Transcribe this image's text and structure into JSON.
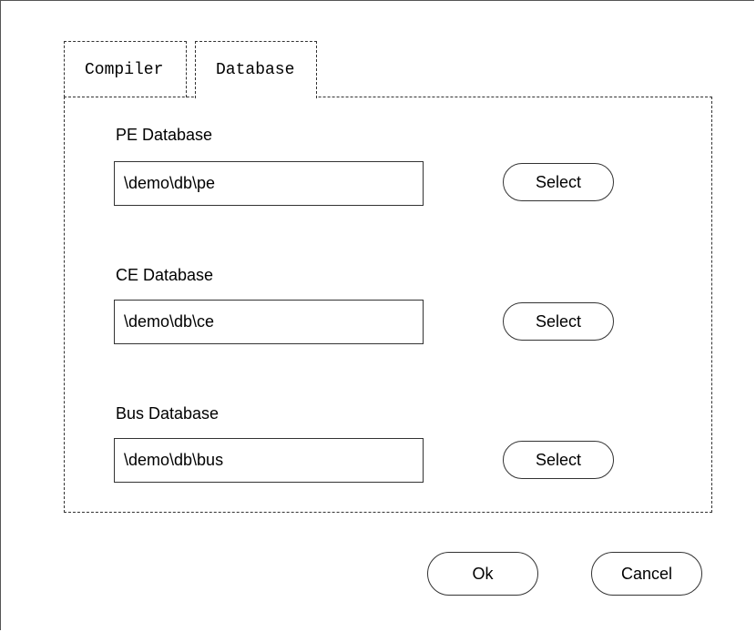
{
  "tabs": [
    {
      "label": "Compiler"
    },
    {
      "label": "Database"
    }
  ],
  "database": {
    "pe": {
      "label": "PE Database",
      "value": "\\demo\\db\\pe",
      "select_label": "Select"
    },
    "ce": {
      "label": "CE Database",
      "value": "\\demo\\db\\ce",
      "select_label": "Select"
    },
    "bus": {
      "label": "Bus Database",
      "value": "\\demo\\db\\bus",
      "select_label": "Select"
    }
  },
  "footer": {
    "ok_label": "Ok",
    "cancel_label": "Cancel"
  }
}
